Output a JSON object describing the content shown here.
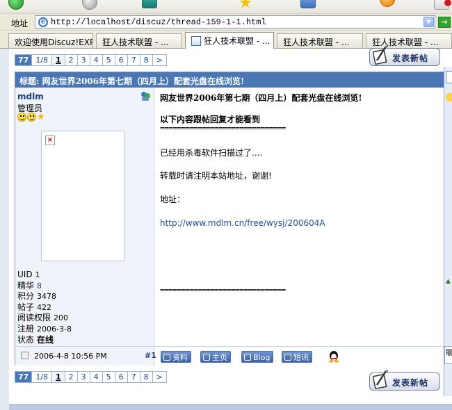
{
  "browser": {
    "address_label": "地址",
    "url": "http://localhost/discuz/thread-159-1-1.html",
    "go_label": "→",
    "tabs": [
      {
        "label": "欢迎使用Discuz!EXP"
      },
      {
        "label": "狂人技术联盟 - ..."
      },
      {
        "label": "狂人技术联盟 - ..."
      },
      {
        "label": "狂人技术联盟 - ..."
      },
      {
        "label": "狂人技术联盟 - ..."
      }
    ]
  },
  "pager": {
    "total": "77",
    "position": "1/8",
    "pages": [
      "1",
      "2",
      "3",
      "4",
      "5",
      "6",
      "7",
      "8"
    ],
    "next": ">"
  },
  "new_post_label": "发表新帖",
  "thread": {
    "title": "标题: 网友世界2006年第七期（四月上）配套光盘在线浏览!",
    "author": {
      "name": "mdlm",
      "group": "管理员",
      "profile": [
        {
          "key": "UID",
          "value": "1"
        },
        {
          "key": "精华",
          "value": "8"
        },
        {
          "key": "积分",
          "value": "3478"
        },
        {
          "key": "帖子",
          "value": "422"
        },
        {
          "key": "阅读权限",
          "value": "200"
        },
        {
          "key": "注册",
          "value": "2006-3-8"
        },
        {
          "key": "状态",
          "value": "在线"
        }
      ]
    },
    "post": {
      "heading": "网友世界2006年第七期（四月上）配套光盘在线浏览!",
      "reply_notice": "以下内容跟帖回复才能看到",
      "separator": "==============================",
      "scanned": "已经用杀毒软件扫描过了....",
      "repost": "转载时请注明本站地址，谢谢!",
      "address_label": "地址：",
      "link": "http://www.mdlm.cn/free/wysj/200604A",
      "separator_end": "=============================="
    },
    "footer": {
      "time": "2006-4-8 10:56 PM",
      "floor": "#1",
      "buttons": [
        "资料",
        "主页",
        "Blog",
        "短讯"
      ]
    }
  },
  "right_panel_text": "聊"
}
